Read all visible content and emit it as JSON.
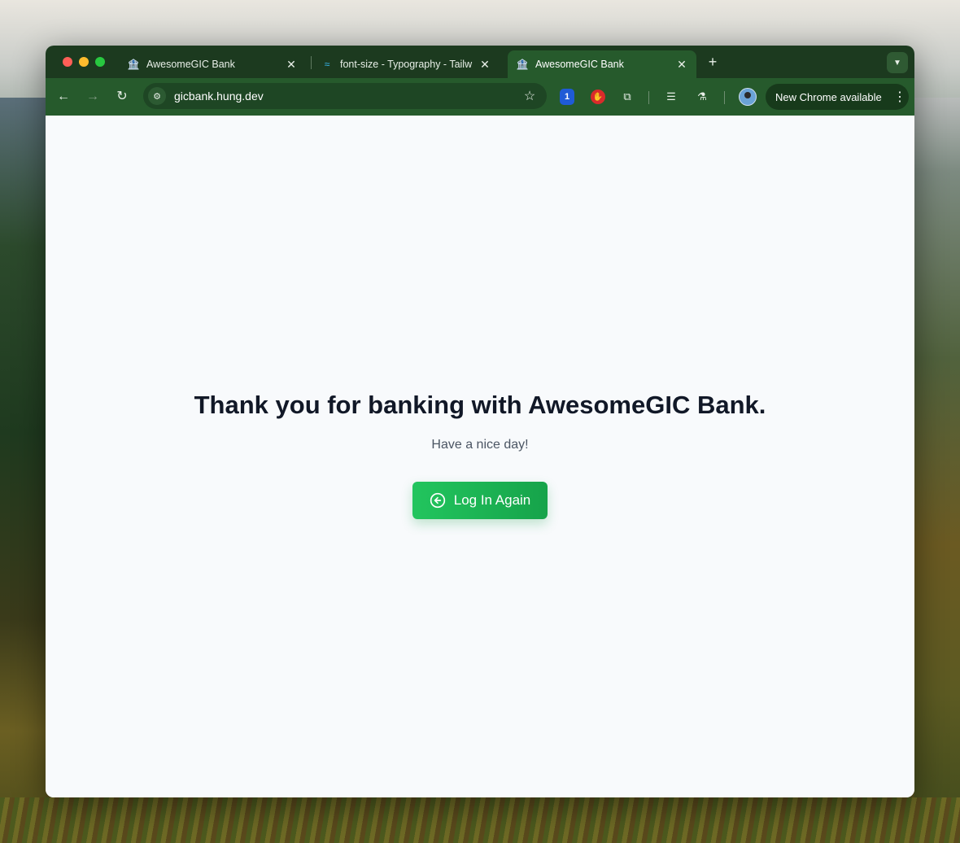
{
  "browser": {
    "tabs": [
      {
        "title": "AwesomeGIC Bank",
        "favicon": "bank-icon",
        "active": false
      },
      {
        "title": "font-size - Typography - Tailw",
        "favicon": "tailwind-icon",
        "active": false
      },
      {
        "title": "AwesomeGIC Bank",
        "favicon": "bank-icon",
        "active": true
      }
    ],
    "url": "gicbank.hung.dev",
    "update_label": "New Chrome available",
    "extension_badge": "1"
  },
  "page": {
    "heading": "Thank you for banking with AwesomeGIC Bank.",
    "subtitle": "Have a nice day!",
    "login_button_label": "Log In Again"
  },
  "colors": {
    "browser_frame": "#265a2c",
    "tab_bar": "#1c3a1f",
    "button_green": "#22c55e",
    "page_bg": "#f8fafc",
    "heading_text": "#111827"
  }
}
